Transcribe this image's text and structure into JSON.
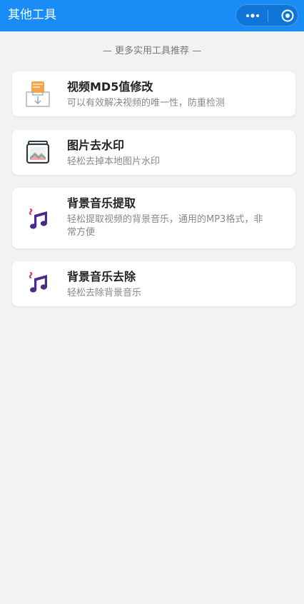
{
  "header": {
    "title": "其他工具"
  },
  "capsule": {
    "more_icon": "more-dots-icon",
    "close_icon": "target-circle-icon"
  },
  "section_hint": "— 更多实用工具推荐 —",
  "tools": [
    {
      "title": "视频MD5值修改",
      "desc": "可以有效解决视频的唯一性，防重检测",
      "icon": "download-box-icon"
    },
    {
      "title": "图片去水印",
      "desc": "轻松去掉本地图片水印",
      "icon": "image-icon"
    },
    {
      "title": "背景音乐提取",
      "desc": "轻松提取视频的背景音乐，通用的MP3格式，非常方便",
      "icon": "music-note-icon"
    },
    {
      "title": "背景音乐去除",
      "desc": "轻松去除背景音乐",
      "icon": "music-note-icon"
    }
  ],
  "colors": {
    "header_bg": "#1a8cf5",
    "page_bg": "#f2f2f2",
    "card_bg": "#ffffff",
    "music_purple": "#4b2a8a",
    "music_pink": "#e0397a"
  }
}
